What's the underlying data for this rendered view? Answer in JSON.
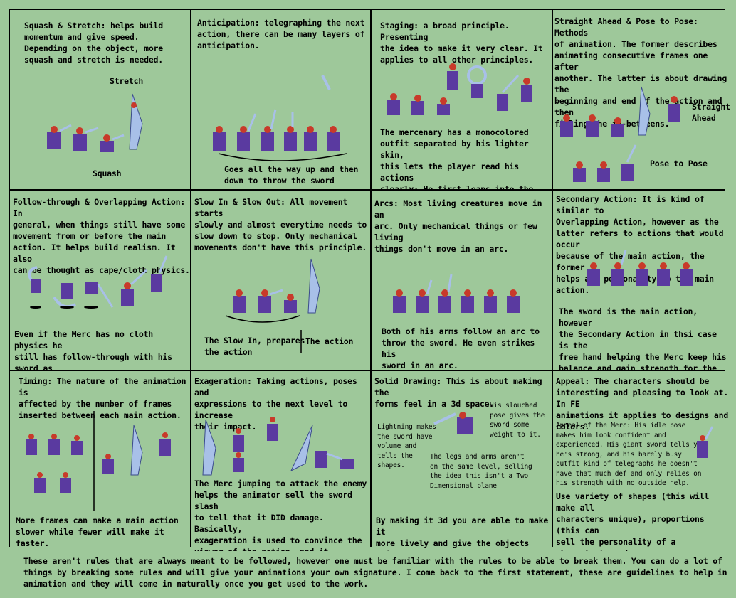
{
  "panels": {
    "squash": {
      "title": "Squash & Stretch: helps build\nmomentum and give speed.\nDepending on the object, more\nsquash and stretch is needed.",
      "label_stretch": "Stretch",
      "label_squash": "Squash"
    },
    "anticipation": {
      "title": "Anticipation: telegraphing the next\naction, there can be  many layers of\nanticipation.",
      "caption": "Goes all the way up and then\ndown to throw the sword"
    },
    "staging": {
      "title": "Staging: a broad principle. Presenting\nthe idea to make it very clear. It\napplies to all other principles.",
      "caption": "The mercenary has a monocolored\noutfit separated by his lighter skin,\nthis lets the player read his actions\nclearly; He first leaps into the air to\nthen strike back down."
    },
    "straight": {
      "title": "Straight Ahead & Pose to Pose: Methods\nof animation. The former describes\nanimating consecutive frames one after\nanother. The latter is about drawing the\nbeginning and end of the action and then\nfilling the in-betweens.",
      "label_straight": "Straight\nAhead",
      "label_pose": "Pose to Pose"
    },
    "follow": {
      "title": "Follow-through & Overlapping Action: In\ngeneral, when things still have some\nmovement from or before the main\naction. It helps build realism. It also\ncan be thought as cape/cloth physics.",
      "caption": "Even if the Merc has no cloth physics he\nstill has follow-through with his sword as\nit trails behind his arm movement."
    },
    "slow": {
      "title": "Slow In & Slow Out: All movement starts\nslowly and almost everytime needs to\nslow down to stop. Only mechanical\nmovements don't have this principle.",
      "label_slowin": "The Slow In, prepares\nthe action",
      "label_action": "The action"
    },
    "arcs": {
      "title": "Arcs: Most living creatures move in an\narc. Only mechanical things or few living\nthings don't move in an arc.",
      "caption": "Both of his arms follow an arc to\nthrow the sword. He even strikes his\nsword in an arc."
    },
    "secondary": {
      "title": "Secondary Action: It is kind of similar to\nOverlapping Action, however as the\nlatter refers to actions that would occur\nbecause of the main action, the former\nhelps add personality to the main action.",
      "caption": "The sword is the main action, however\nthe Secondary Action in thsi case is the\nfree hand helping the Merc keep his\nbalance and gain strength for the\nthrowing."
    },
    "timing": {
      "title": "Timing: The nature of the animation is\naffected by the number of frames\ninserted between each main action.",
      "caption": "More frames can make a main action\nslower while fewer will make it faster."
    },
    "exag": {
      "title": "Exageration: Taking actions, poses and\nexpressions to the next level to increase\ntheir impact.",
      "caption": "The Merc jumping to attack the enemy\nhelps the animator sell the sword slash\nto tell that it DID damage. Basically,\nexageration is used to convince the\nviewer of the action, and it sometimes\nmeans being unrealistic to a tiny extent."
    },
    "solid": {
      "title": "Solid Drawing: This is about making the\nforms feel in a 3d space.",
      "note_lightning": "Lightning makes\nthe sword have\nvolume and\ntells the\nshapes.",
      "note_slouch": "His slouched\npose gives the\nsword some\nweight to it.",
      "note_legs": "The legs and arms aren't\non the same level, selling\nthe idea this isn't a Two\nDimensional plane",
      "caption": "By making it 3d you are able to make it\nmore lively and give the objects weight\nand volume."
    },
    "appeal": {
      "title": "Appeal: The characters should be\ninteresting and pleasing to look at. In FE\nanimations it applies to designs and\ncolors.",
      "note": "Appeal of the Merc: His idle pose\nmakes him look confident and\nexperienced. His giant sword tells you\nhe's strong, and his barely busy\noutfit kind of telegraphs he doesn't\nhave that much def and only relies on\nhis strength with no outside help.",
      "caption": "Use variety of shapes (this will make all\ncharacters unique), proportions (this can\nsell the personality of a character), and\nkeep it simple, because you WILL draw\nthis many times."
    }
  },
  "footer": "These aren't rules that are always meant to be followed, however one must be familiar with the rules to be able to break them. You can do a lot of things by breaking some rules and will give your animations your own signature. I come back to the first statement, these are guidelines to help in animation and they will come in naturally once you get used to the work.",
  "colors": {
    "background": "#9ec89a",
    "outfit": "#5a3aa0",
    "hair": "#c83a2a",
    "skin": "#f0c8a0",
    "sword": "#a8c0e8"
  }
}
